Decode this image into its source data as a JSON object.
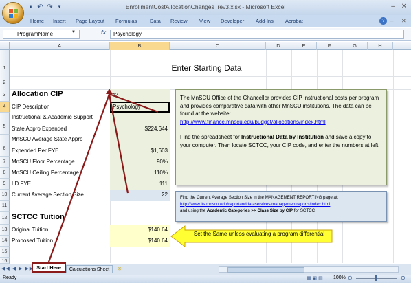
{
  "window": {
    "title": "EnrollmentCostAllocationChanges_rev3.xlsx - Microsoft Excel",
    "qat": [
      "save-icon",
      "undo-icon",
      "redo-icon",
      "customize-icon"
    ],
    "controls": [
      "–",
      "✕"
    ]
  },
  "ribbon": {
    "tabs": [
      "Home",
      "Insert",
      "Page Layout",
      "Formulas",
      "Data",
      "Review",
      "View",
      "Developer",
      "Add-Ins",
      "Acrobat"
    ]
  },
  "formula_bar": {
    "name_box": "ProgramName",
    "fx": "fx",
    "content": "Psychology"
  },
  "columns": [
    "A",
    "B",
    "C",
    "D",
    "E",
    "F",
    "G",
    "H"
  ],
  "rows": [
    "1",
    "2",
    "3",
    "4",
    "5",
    "6",
    "7",
    "8",
    "9",
    "10",
    "11",
    "12",
    "13",
    "14",
    "15",
    "16"
  ],
  "sheet": {
    "title": "Enter Starting Data",
    "a3": "Allocation CIP",
    "b3": "42",
    "a4": "CIP Description",
    "b4": "Psychology",
    "a5_line1": "Instructional & Academic Support",
    "a5_line2": "State Appro Expended",
    "b5": "$224,644",
    "a6_line1": "MnSCU Average State Appro",
    "a6_line2": "Expended Per FYE",
    "b6": "$1,603",
    "a7": "MnSCU Floor Percentage",
    "b7": "90%",
    "a8": "MnSCU Ceiling Percentage",
    "b8": "110%",
    "a9": "LD FYE",
    "b9": "111",
    "a10": "Current Average Section Size",
    "b10": "22",
    "a12": "SCTCC Tuition",
    "a13": "Original Tuition",
    "b13": "$140.64",
    "a14": "Proposed Tuition",
    "b14": "$140.64"
  },
  "note1": {
    "p1": "The MnSCU Office of the Chancellor provides CIP instructional costs per program and provides comparative data with other MnSCU institutions.  The data can be found at the website:",
    "link": "http://www.finance.mnscu.edu/budget/allocations/index.html",
    "p2a": "Find the spreadsheet for ",
    "p2b": "Instructional Data by Institution",
    "p2c": " and save a copy to your computer.   Then locate SCTCC, your CIP code, and enter the numbers at left."
  },
  "note2": {
    "p1": "Find the Current Average Section Size in the MANAGEMENT  REPORTING page at:",
    "link": "http://www.its.mnscu.edu/reportanddataservices/managementreports/index.html",
    "p2a": "and using the ",
    "p2b": "Academic Categories >> Class Size by CIP",
    "p2c": " for SCTCC"
  },
  "callout": "Set the Same unless evaluating a program differential",
  "sheet_tabs": [
    "Start Here",
    "Calculations Sheet"
  ],
  "status": {
    "ready": "Ready",
    "zoom": "100%"
  },
  "colors": {
    "accent_red": "#8b1a1a",
    "green_fill": "#ebf1de",
    "blue_fill": "#dce6f1",
    "yellow_fill": "#ffffcc",
    "callout_yellow": "#ffff33"
  }
}
